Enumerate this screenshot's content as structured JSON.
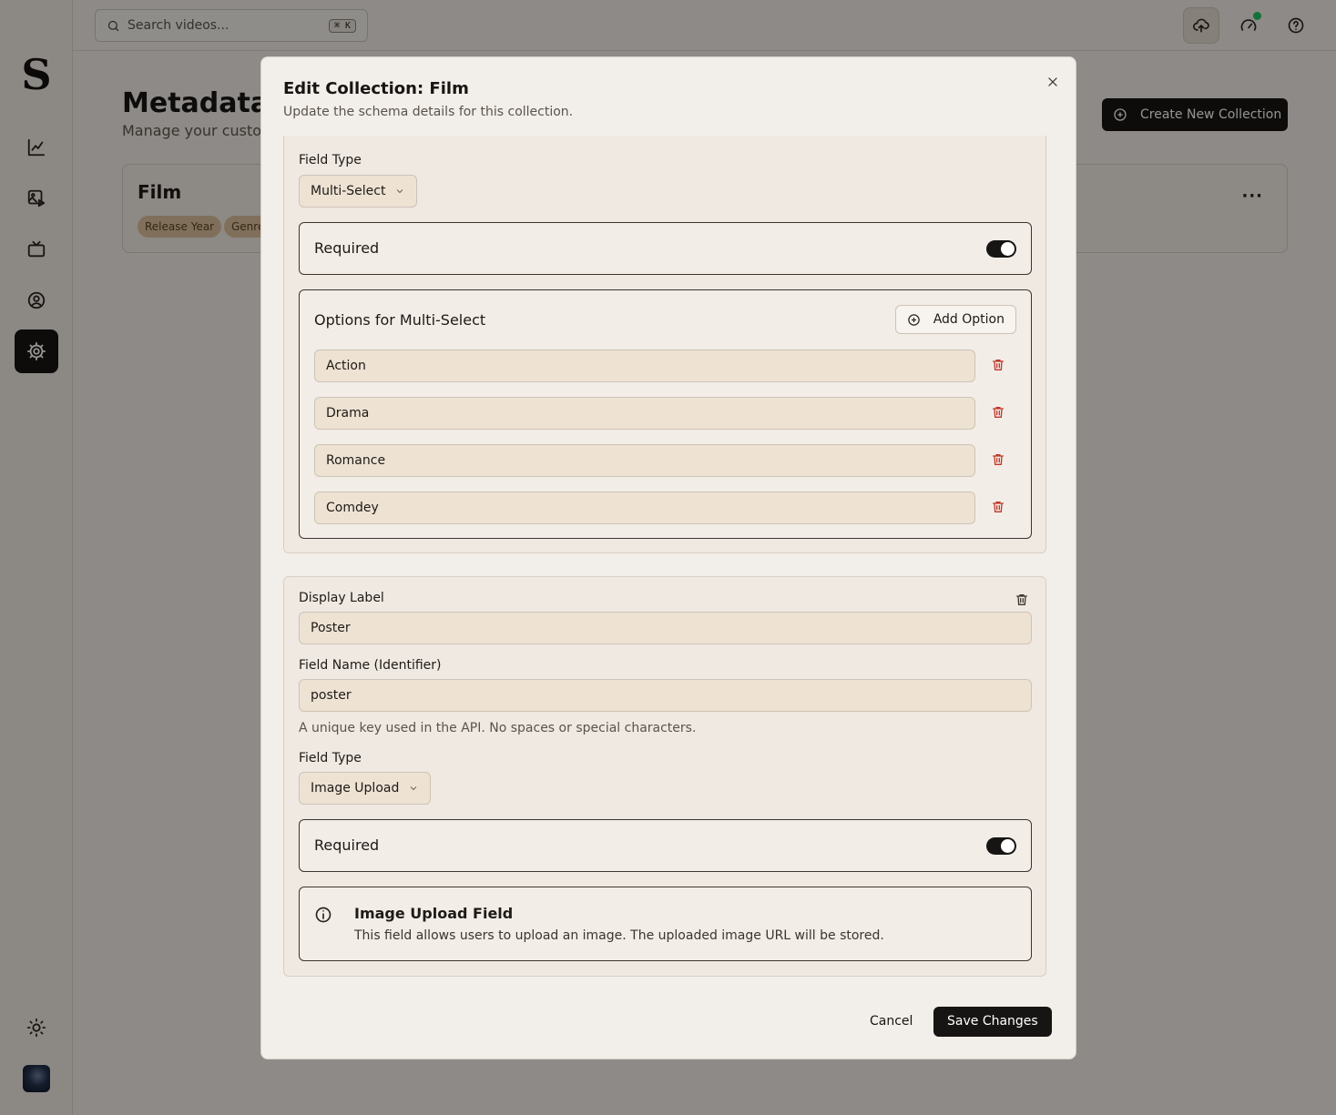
{
  "topbar": {
    "search_placeholder": "Search videos...",
    "shortcut": "⌘ K"
  },
  "sidebar": {
    "logo": "S",
    "items": [
      {
        "name": "analytics"
      },
      {
        "name": "media"
      },
      {
        "name": "channels"
      },
      {
        "name": "account"
      },
      {
        "name": "settings",
        "active": true
      }
    ]
  },
  "page": {
    "title": "Metadata",
    "subtitle": "Manage your custon",
    "create_button": "Create New Collection",
    "card": {
      "title": "Film",
      "badges": [
        "Release Year",
        "Genre"
      ]
    }
  },
  "modal": {
    "title": "Edit Collection: Film",
    "description": "Update the schema details for this collection.",
    "field1": {
      "field_type_label": "Field Type",
      "field_type_value": "Multi-Select",
      "required_label": "Required",
      "required": true,
      "options_title": "Options for Multi-Select",
      "add_option": "Add Option",
      "options": [
        "Action",
        "Drama",
        "Romance",
        "Comdey"
      ]
    },
    "field2": {
      "display_label_label": "Display Label",
      "display_label_value": "Poster",
      "field_name_label": "Field Name (Identifier)",
      "field_name_value": "poster",
      "field_name_help": "A unique key used in the API. No spaces or special characters.",
      "field_type_label": "Field Type",
      "field_type_value": "Image Upload",
      "required_label": "Required",
      "required": true,
      "info_title": "Image Upload Field",
      "info_text": "This field allows users to upload an image. The uploaded image URL will be stored."
    },
    "cancel": "Cancel",
    "save": "Save Changes"
  },
  "colors": {
    "primary": "#171513",
    "danger": "#c0392b",
    "badge": "#dcc29d",
    "status_online": "#22c55e"
  }
}
